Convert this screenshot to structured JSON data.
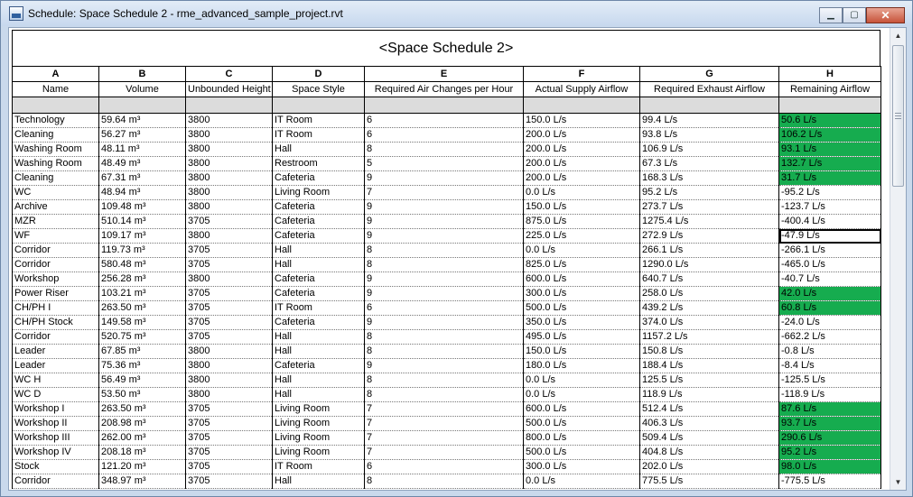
{
  "window": {
    "title": "Schedule: Space Schedule 2 - rme_advanced_sample_project.rvt",
    "minimize_glyph": "▁",
    "maximize_glyph": "▢",
    "close_glyph": "✕"
  },
  "schedule": {
    "title": "<Space Schedule 2>",
    "column_letters": [
      "A",
      "B",
      "C",
      "D",
      "E",
      "F",
      "G",
      "H"
    ],
    "column_headers": [
      "Name",
      "Volume",
      "Unbounded Height",
      "Space Style",
      "Required Air Changes per Hour",
      "Actual Supply Airflow",
      "Required Exhaust Airflow",
      "Remaining Airflow"
    ],
    "highlight_color": "#16ac4f",
    "rows": [
      {
        "name": "Technology",
        "volume": "59.64 m³",
        "height": "3800",
        "style": "IT Room",
        "ach": "6",
        "supply": "150.0 L/s",
        "exhaust": "99.4 L/s",
        "remaining": "50.6 L/s",
        "positive": true
      },
      {
        "name": "Cleaning",
        "volume": "56.27 m³",
        "height": "3800",
        "style": "IT Room",
        "ach": "6",
        "supply": "200.0 L/s",
        "exhaust": "93.8 L/s",
        "remaining": "106.2 L/s",
        "positive": true
      },
      {
        "name": "Washing Room",
        "volume": "48.11 m³",
        "height": "3800",
        "style": "Hall",
        "ach": "8",
        "supply": "200.0 L/s",
        "exhaust": "106.9 L/s",
        "remaining": "93.1 L/s",
        "positive": true
      },
      {
        "name": "Washing Room",
        "volume": "48.49 m³",
        "height": "3800",
        "style": "Restroom",
        "ach": "5",
        "supply": "200.0 L/s",
        "exhaust": "67.3 L/s",
        "remaining": "132.7 L/s",
        "positive": true
      },
      {
        "name": "Cleaning",
        "volume": "67.31 m³",
        "height": "3800",
        "style": "Cafeteria",
        "ach": "9",
        "supply": "200.0 L/s",
        "exhaust": "168.3 L/s",
        "remaining": "31.7 L/s",
        "positive": true
      },
      {
        "name": "WC",
        "volume": "48.94 m³",
        "height": "3800",
        "style": "Living Room",
        "ach": "7",
        "supply": "0.0 L/s",
        "exhaust": "95.2 L/s",
        "remaining": "-95.2 L/s",
        "positive": false
      },
      {
        "name": "Archive",
        "volume": "109.48 m³",
        "height": "3800",
        "style": "Cafeteria",
        "ach": "9",
        "supply": "150.0 L/s",
        "exhaust": "273.7 L/s",
        "remaining": "-123.7 L/s",
        "positive": false
      },
      {
        "name": "MZR",
        "volume": "510.14 m³",
        "height": "3705",
        "style": "Cafeteria",
        "ach": "9",
        "supply": "875.0 L/s",
        "exhaust": "1275.4 L/s",
        "remaining": "-400.4 L/s",
        "positive": false
      },
      {
        "name": "WF",
        "volume": "109.17 m³",
        "height": "3800",
        "style": "Cafeteria",
        "ach": "9",
        "supply": "225.0 L/s",
        "exhaust": "272.9 L/s",
        "remaining": "-47.9 L/s",
        "positive": false,
        "selected": true
      },
      {
        "name": "Corridor",
        "volume": "119.73 m³",
        "height": "3705",
        "style": "Hall",
        "ach": "8",
        "supply": "0.0 L/s",
        "exhaust": "266.1 L/s",
        "remaining": "-266.1 L/s",
        "positive": false
      },
      {
        "name": "Corridor",
        "volume": "580.48 m³",
        "height": "3705",
        "style": "Hall",
        "ach": "8",
        "supply": "825.0 L/s",
        "exhaust": "1290.0 L/s",
        "remaining": "-465.0 L/s",
        "positive": false
      },
      {
        "name": "Workshop",
        "volume": "256.28 m³",
        "height": "3800",
        "style": "Cafeteria",
        "ach": "9",
        "supply": "600.0 L/s",
        "exhaust": "640.7 L/s",
        "remaining": "-40.7 L/s",
        "positive": false
      },
      {
        "name": "Power Riser",
        "volume": "103.21 m³",
        "height": "3705",
        "style": "Cafeteria",
        "ach": "9",
        "supply": "300.0 L/s",
        "exhaust": "258.0 L/s",
        "remaining": "42.0 L/s",
        "positive": true
      },
      {
        "name": "CH/PH I",
        "volume": "263.50 m³",
        "height": "3705",
        "style": "IT Room",
        "ach": "6",
        "supply": "500.0 L/s",
        "exhaust": "439.2 L/s",
        "remaining": "60.8 L/s",
        "positive": true
      },
      {
        "name": "CH/PH Stock",
        "volume": "149.58 m³",
        "height": "3705",
        "style": "Cafeteria",
        "ach": "9",
        "supply": "350.0 L/s",
        "exhaust": "374.0 L/s",
        "remaining": "-24.0 L/s",
        "positive": false
      },
      {
        "name": "Corridor",
        "volume": "520.75 m³",
        "height": "3705",
        "style": "Hall",
        "ach": "8",
        "supply": "495.0 L/s",
        "exhaust": "1157.2 L/s",
        "remaining": "-662.2 L/s",
        "positive": false
      },
      {
        "name": "Leader",
        "volume": "67.85 m³",
        "height": "3800",
        "style": "Hall",
        "ach": "8",
        "supply": "150.0 L/s",
        "exhaust": "150.8 L/s",
        "remaining": "-0.8 L/s",
        "positive": false
      },
      {
        "name": "Leader",
        "volume": "75.36 m³",
        "height": "3800",
        "style": "Cafeteria",
        "ach": "9",
        "supply": "180.0 L/s",
        "exhaust": "188.4 L/s",
        "remaining": "-8.4 L/s",
        "positive": false
      },
      {
        "name": "WC H",
        "volume": "56.49 m³",
        "height": "3800",
        "style": "Hall",
        "ach": "8",
        "supply": "0.0 L/s",
        "exhaust": "125.5 L/s",
        "remaining": "-125.5 L/s",
        "positive": false
      },
      {
        "name": "WC D",
        "volume": "53.50 m³",
        "height": "3800",
        "style": "Hall",
        "ach": "8",
        "supply": "0.0 L/s",
        "exhaust": "118.9 L/s",
        "remaining": "-118.9 L/s",
        "positive": false
      },
      {
        "name": "Workshop I",
        "volume": "263.50 m³",
        "height": "3705",
        "style": "Living Room",
        "ach": "7",
        "supply": "600.0 L/s",
        "exhaust": "512.4 L/s",
        "remaining": "87.6 L/s",
        "positive": true
      },
      {
        "name": "Workshop II",
        "volume": "208.98 m³",
        "height": "3705",
        "style": "Living Room",
        "ach": "7",
        "supply": "500.0 L/s",
        "exhaust": "406.3 L/s",
        "remaining": "93.7 L/s",
        "positive": true
      },
      {
        "name": "Workshop III",
        "volume": "262.00 m³",
        "height": "3705",
        "style": "Living Room",
        "ach": "7",
        "supply": "800.0 L/s",
        "exhaust": "509.4 L/s",
        "remaining": "290.6 L/s",
        "positive": true
      },
      {
        "name": "Workshop IV",
        "volume": "208.18 m³",
        "height": "3705",
        "style": "Living Room",
        "ach": "7",
        "supply": "500.0 L/s",
        "exhaust": "404.8 L/s",
        "remaining": "95.2 L/s",
        "positive": true
      },
      {
        "name": "Stock",
        "volume": "121.20 m³",
        "height": "3705",
        "style": "IT Room",
        "ach": "6",
        "supply": "300.0 L/s",
        "exhaust": "202.0 L/s",
        "remaining": "98.0 L/s",
        "positive": true
      },
      {
        "name": "Corridor",
        "volume": "348.97 m³",
        "height": "3705",
        "style": "Hall",
        "ach": "8",
        "supply": "0.0 L/s",
        "exhaust": "775.5 L/s",
        "remaining": "-775.5 L/s",
        "positive": false
      }
    ]
  },
  "scrollbar": {
    "up_glyph": "▲",
    "down_glyph": "▼"
  }
}
